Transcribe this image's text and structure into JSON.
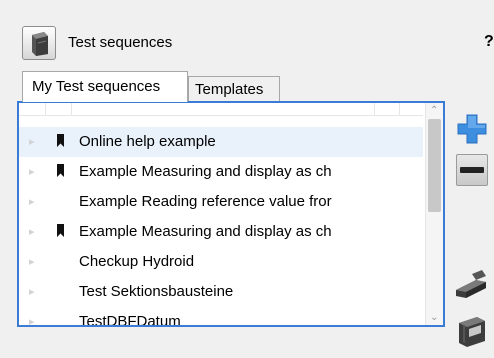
{
  "header": {
    "title": "Test sequences",
    "help_label": "?"
  },
  "tabs": [
    {
      "label": "My Test sequences",
      "active": true
    },
    {
      "label": "Templates",
      "active": false
    }
  ],
  "list": {
    "items": [
      {
        "label": "Online help example",
        "bookmarked": true,
        "selected": true
      },
      {
        "label": "Example Measuring and display as ch",
        "bookmarked": true,
        "selected": false
      },
      {
        "label": "Example Reading reference value fror",
        "bookmarked": false,
        "selected": false
      },
      {
        "label": "Example Measuring and display as ch",
        "bookmarked": true,
        "selected": false
      },
      {
        "label": "Checkup Hydroid",
        "bookmarked": false,
        "selected": false
      },
      {
        "label": "Test Sektionsbausteine",
        "bookmarked": false,
        "selected": false
      },
      {
        "label": "TestDBFDatum",
        "bookmarked": false,
        "selected": false
      }
    ]
  },
  "icons": {
    "app": "binder-icon",
    "add": "plus-icon",
    "remove": "minus-icon",
    "open": "open-folder-icon",
    "save": "save-icon",
    "bookmark": "bookmark-icon",
    "expand": "expand-arrow-icon"
  },
  "colors": {
    "focus_border": "#3a7bd5",
    "add_button": "#3e8ee0",
    "selected_row": "#e9f1fb"
  }
}
